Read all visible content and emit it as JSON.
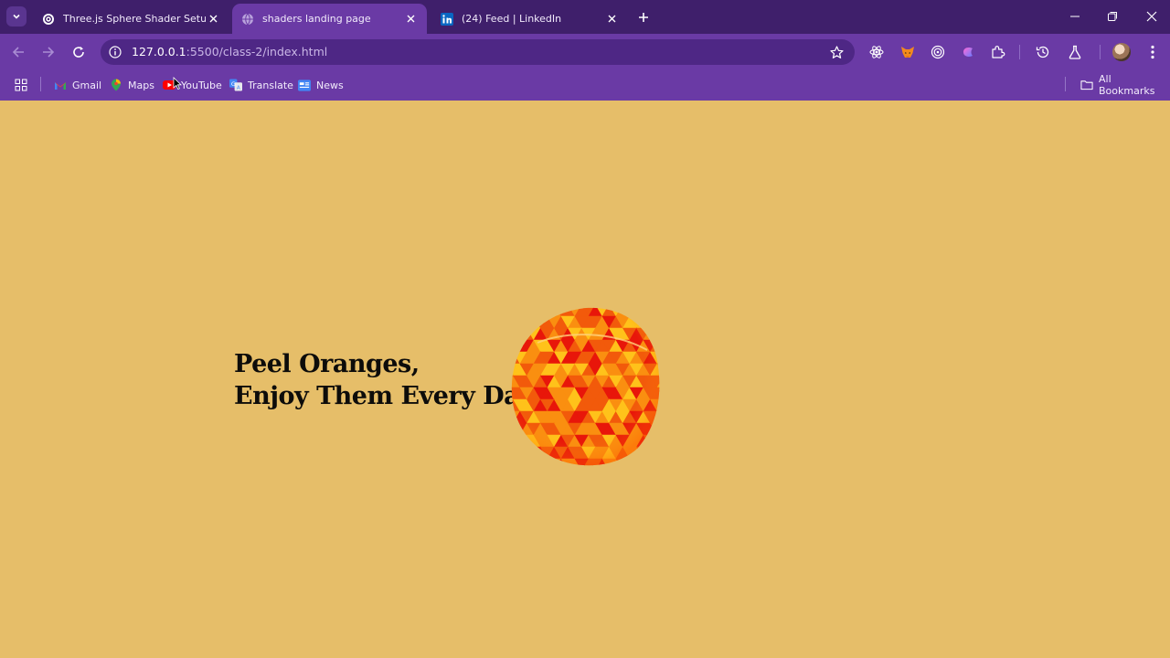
{
  "browser": {
    "tabs": [
      {
        "title": "Three.js Sphere Shader Setup",
        "favicon": "openai-icon",
        "active": false
      },
      {
        "title": "shaders landing page",
        "favicon": "globe-icon",
        "active": true
      },
      {
        "title": "(24) Feed | LinkedIn",
        "favicon": "linkedin-icon",
        "active": false
      }
    ],
    "address": {
      "host": "127.0.0.1",
      "path": ":5500/class-2/index.html"
    },
    "bookmarks": [
      {
        "label": "Gmail",
        "icon": "gmail-icon"
      },
      {
        "label": "Maps",
        "icon": "maps-icon"
      },
      {
        "label": "YouTube",
        "icon": "youtube-icon"
      },
      {
        "label": "Translate",
        "icon": "translate-icon"
      },
      {
        "label": "News",
        "icon": "news-icon"
      }
    ],
    "all_bookmarks_label": "All Bookmarks",
    "colors": {
      "frame": "#3f1f6b",
      "toolbar": "#6a3aa5",
      "omnibox": "#4e2785"
    }
  },
  "page": {
    "headline_line1": "Peel Oranges,",
    "headline_line2": "Enjoy Them Every Day.",
    "background": "#e6be69",
    "sphere": {
      "icon": "orange-sphere",
      "colors": [
        "#e8160a",
        "#f25a0b",
        "#fa8f10",
        "#ffc21a"
      ]
    }
  }
}
